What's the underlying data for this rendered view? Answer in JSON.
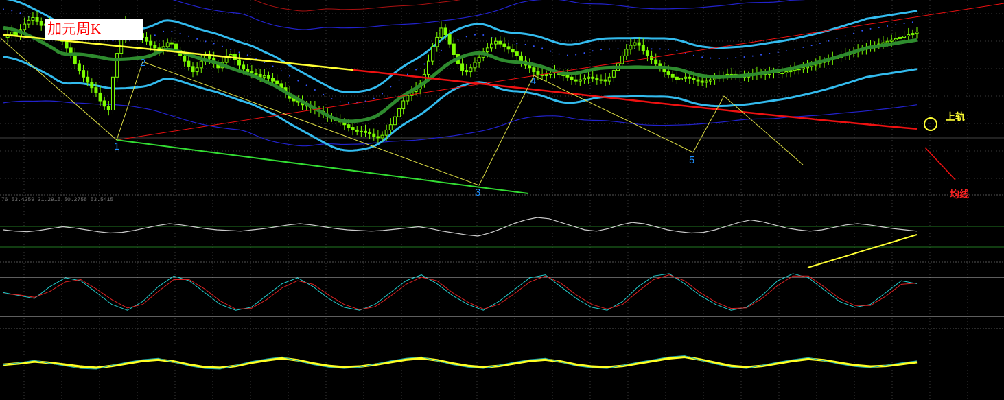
{
  "chart_title": "加元周K",
  "annotations": {
    "upper_rail": "上轨",
    "moving_average": "均线"
  },
  "indicator_readout": "76 53.4259 31.2915 50.2758 53.5415",
  "wave_labels": [
    "1",
    "2",
    "3",
    "4",
    "5"
  ],
  "colors": {
    "background": "#000000",
    "candles": "#7cfc00",
    "ma_green": "#2e8b2e",
    "bb_upper_lower": "#33bbee",
    "red_ma": "#ee1111",
    "yellow_ma": "#ffff33",
    "outer_band_blue": "#2222cc",
    "outer_band_red": "#aa1111",
    "trendline_green": "#33dd33",
    "grid": "#3a3a3a"
  },
  "chart_data": [
    {
      "type": "candlestick",
      "panel": "main",
      "title": "加元周K",
      "x": [
        0,
        1,
        2,
        3,
        4,
        5,
        6,
        7,
        8,
        9,
        10,
        11,
        12,
        13,
        14,
        15,
        16,
        17,
        18,
        19,
        20,
        21,
        22,
        23,
        24,
        25,
        26,
        27,
        28,
        29,
        30,
        31,
        32,
        33,
        34,
        35,
        36,
        37,
        38,
        39,
        40,
        41,
        42,
        43,
        44,
        45,
        46,
        47,
        48,
        49,
        50,
        51,
        52,
        53,
        54,
        55,
        56,
        57,
        58,
        59,
        60,
        61,
        62,
        63,
        64,
        65,
        66,
        67,
        68,
        69,
        70,
        71,
        72,
        73,
        74,
        75,
        76,
        77,
        78,
        79,
        80,
        81,
        82,
        83,
        84,
        85,
        86,
        87,
        88,
        89,
        90,
        91,
        92,
        93,
        94,
        95,
        96,
        97,
        98,
        99,
        100,
        101,
        102,
        103,
        104,
        105,
        106,
        107,
        108,
        109,
        110,
        111,
        112,
        113,
        114,
        115,
        116,
        117,
        118,
        119,
        120,
        121,
        122,
        123,
        124,
        125,
        126,
        127,
        128,
        129,
        130,
        131,
        132,
        133,
        134,
        135,
        136,
        137,
        138,
        139,
        140,
        141,
        142,
        143,
        144,
        145,
        146,
        147,
        148,
        149,
        150,
        151,
        152,
        153,
        154,
        155,
        156,
        157,
        158,
        159,
        160,
        161,
        162,
        163,
        164,
        165,
        166,
        167,
        168,
        169,
        170,
        171,
        172,
        173,
        174,
        175,
        176,
        177,
        178,
        179,
        180,
        181,
        182,
        183,
        184,
        185,
        186,
        187,
        188,
        189,
        190,
        191,
        192,
        193,
        194,
        195,
        196,
        197,
        198,
        199,
        200,
        201,
        202,
        203,
        204,
        205,
        206,
        207,
        208,
        209,
        210,
        211,
        212,
        213,
        214,
        215,
        216,
        217,
        218,
        219
      ],
      "close": [
        118,
        120,
        122,
        119,
        124,
        128,
        131,
        133,
        130,
        127,
        128,
        126,
        123,
        119,
        115,
        110,
        105,
        98,
        93,
        88,
        84,
        80,
        76,
        70,
        66,
        63,
        88,
        106,
        118,
        129,
        126,
        124,
        121,
        118,
        115,
        112,
        110,
        108,
        111,
        114,
        113,
        108,
        104,
        100,
        96,
        92,
        95,
        100,
        104,
        102,
        98,
        95,
        99,
        104,
        105,
        101,
        97,
        94,
        92,
        91,
        90,
        88,
        89,
        87,
        85,
        83,
        80,
        76,
        72,
        70,
        69,
        67,
        66,
        65,
        63,
        62,
        60,
        58,
        57,
        55,
        54,
        52,
        50,
        48,
        47,
        47,
        46,
        45,
        43,
        42,
        44,
        48,
        52,
        58,
        64,
        70,
        74,
        77,
        79,
        83,
        90,
        100,
        111,
        118,
        125,
        120,
        113,
        105,
        98,
        93,
        92,
        95,
        99,
        103,
        107,
        110,
        113,
        115,
        113,
        111,
        109,
        107,
        104,
        100,
        97,
        95,
        92,
        90,
        89,
        90,
        91,
        92,
        90,
        89,
        88,
        86,
        85,
        86,
        87,
        88,
        87,
        86,
        86,
        85,
        88,
        93,
        98,
        104,
        109,
        112,
        114,
        112,
        108,
        104,
        101,
        98,
        95,
        92,
        90,
        88,
        86,
        87,
        88,
        87,
        86,
        85,
        84,
        85,
        86,
        87,
        88,
        89,
        90,
        90,
        89,
        88,
        88,
        89,
        90,
        91,
        90,
        90,
        91,
        92,
        91,
        91,
        92,
        93,
        94,
        94,
        95,
        96,
        97,
        98,
        99,
        100,
        101,
        102,
        103,
        104,
        105,
        106,
        107,
        108,
        109,
        110,
        111,
        112,
        113,
        114,
        115,
        116,
        117,
        118,
        119,
        120,
        121,
        122
      ],
      "ylim": [
        0,
        140
      ]
    },
    {
      "type": "line",
      "panel": "oscillator",
      "series": [
        {
          "values": [
            50,
            48,
            47,
            49,
            52,
            55,
            53,
            50,
            47,
            45,
            46,
            49,
            53,
            57,
            60,
            58,
            55,
            52,
            50,
            49,
            48,
            50,
            52,
            55,
            58,
            60,
            58,
            55,
            52,
            50,
            49,
            48,
            49,
            51,
            53,
            55,
            52,
            48,
            45,
            42,
            40,
            45,
            52,
            60,
            66,
            70,
            68,
            62,
            56,
            50,
            48,
            52,
            58,
            62,
            60,
            55,
            50,
            47,
            45,
            46,
            50,
            56,
            62,
            66,
            63,
            58,
            53,
            50,
            48,
            50,
            54,
            58,
            60,
            58,
            55,
            52,
            50,
            48
          ]
        }
      ],
      "ylim": [
        0,
        100
      ]
    },
    {
      "type": "line",
      "panel": "stochastic",
      "series": [
        {
          "values": [
            60,
            55,
            50,
            70,
            85,
            80,
            60,
            40,
            30,
            45,
            70,
            88,
            80,
            60,
            40,
            30,
            35,
            55,
            75,
            85,
            70,
            50,
            35,
            30,
            40,
            60,
            80,
            90,
            75,
            55,
            40,
            30,
            45,
            65,
            85,
            90,
            70,
            50,
            35,
            30,
            45,
            70,
            88,
            92,
            75,
            55,
            40,
            30,
            35,
            55,
            80,
            92,
            85,
            65,
            45,
            35,
            40,
            60,
            80,
            75
          ]
        },
        {
          "values": [
            58,
            56,
            52,
            62,
            78,
            82,
            66,
            48,
            34,
            40,
            62,
            82,
            82,
            66,
            46,
            32,
            33,
            48,
            68,
            80,
            74,
            56,
            40,
            31,
            36,
            54,
            74,
            86,
            80,
            60,
            44,
            32,
            40,
            58,
            78,
            88,
            76,
            56,
            40,
            32,
            40,
            62,
            82,
            90,
            80,
            60,
            44,
            33,
            34,
            50,
            72,
            88,
            88,
            70,
            50,
            38,
            38,
            54,
            74,
            76
          ]
        }
      ],
      "ylim": [
        0,
        100
      ]
    },
    {
      "type": "line",
      "panel": "momentum",
      "series": [
        {
          "values": [
            50,
            52,
            55,
            53,
            50,
            47,
            45,
            48,
            52,
            56,
            58,
            55,
            50,
            46,
            45,
            48,
            53,
            57,
            60,
            57,
            52,
            48,
            46,
            47,
            50,
            54,
            58,
            60,
            57,
            52,
            48,
            46,
            48,
            52,
            56,
            58,
            55,
            50,
            47,
            46,
            48,
            52,
            56,
            60,
            62,
            58,
            53,
            48,
            46,
            48,
            52,
            56,
            59,
            57,
            53,
            49,
            47,
            48,
            51,
            54
          ]
        },
        {
          "values": [
            50,
            53,
            57,
            52,
            48,
            44,
            43,
            49,
            54,
            58,
            60,
            54,
            48,
            44,
            43,
            49,
            55,
            59,
            62,
            56,
            50,
            46,
            44,
            46,
            51,
            56,
            60,
            62,
            56,
            50,
            46,
            44,
            49,
            54,
            58,
            60,
            54,
            48,
            45,
            44,
            49,
            54,
            58,
            62,
            64,
            57,
            51,
            46,
            44,
            49,
            54,
            58,
            61,
            56,
            51,
            47,
            45,
            49,
            53,
            56
          ]
        }
      ],
      "ylim": [
        0,
        100
      ]
    }
  ]
}
